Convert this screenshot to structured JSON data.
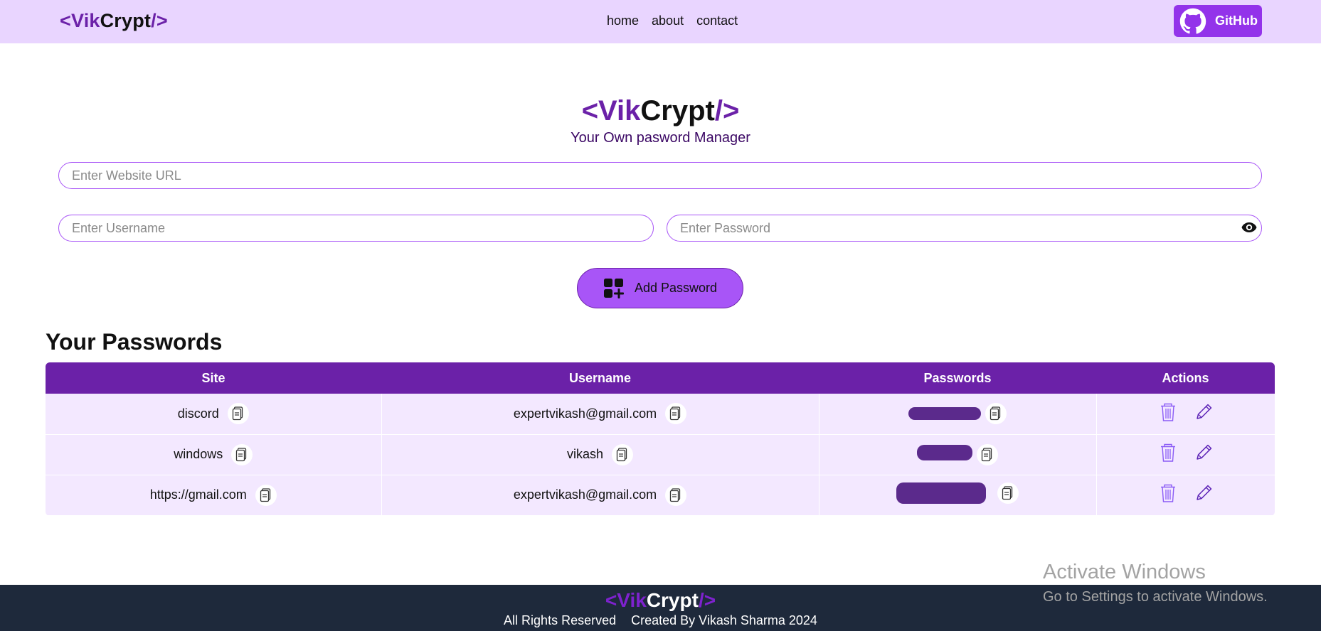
{
  "navbar": {
    "logo": {
      "lt": "<",
      "vik": "Vik",
      "crypt": "Crypt",
      "slash_gt": "/>"
    },
    "links": [
      "home",
      "about",
      "contact"
    ],
    "github_label": "GitHub"
  },
  "hero": {
    "logo": {
      "lt": "<",
      "vik": "Vik",
      "crypt": "Crypt",
      "slash_gt": "/>"
    },
    "subtitle": "Your Own pasword Manager"
  },
  "form": {
    "url_placeholder": "Enter Website URL",
    "username_placeholder": "Enter Username",
    "password_placeholder": "Enter Password",
    "add_button_label": "Add Password"
  },
  "passwords": {
    "title": "Your Passwords",
    "headers": [
      "Site",
      "Username",
      "Passwords",
      "Actions"
    ],
    "rows": [
      {
        "site": "discord",
        "username": "expertvikash@gmail.com"
      },
      {
        "site": "windows",
        "username": "vikash"
      },
      {
        "site": "https://gmail.com",
        "username": "expertvikash@gmail.com"
      }
    ]
  },
  "watermark": {
    "line1": "Activate Windows",
    "line2": "Go to Settings to activate Windows."
  },
  "footer": {
    "logo": {
      "lt": "<",
      "vik": "Vik",
      "crypt": "Crypt",
      "slash_gt": "/>"
    },
    "rights": "All Rights Reserved",
    "credit": "Created By Vikash Sharma 2024"
  },
  "colors": {
    "nav_bg": "#e9d5ff",
    "accent": "#6b21a8",
    "button": "#a855f7",
    "row_bg": "#f3e8ff",
    "footer_bg": "#1e293b"
  },
  "icons": [
    "github-icon",
    "eye-icon",
    "add-grid-icon",
    "copy-icon",
    "delete-icon",
    "edit-icon"
  ]
}
